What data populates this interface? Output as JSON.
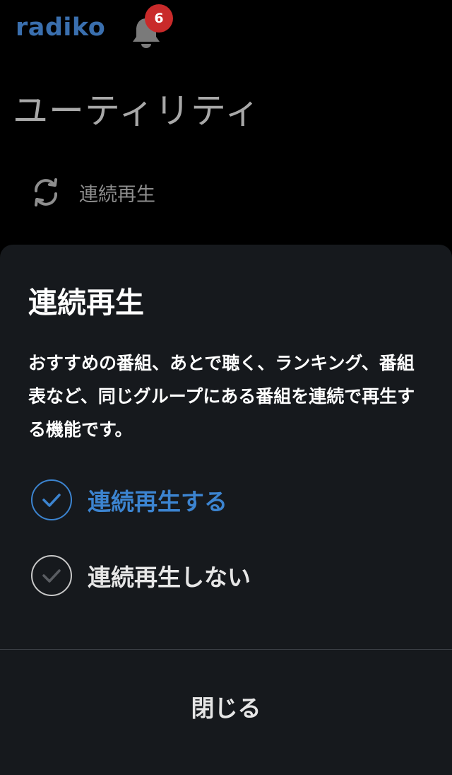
{
  "header": {
    "logo_text": "radiko",
    "notification_count": "6",
    "colors": {
      "logo": "#3a6fae",
      "badge": "#c92a2a",
      "bell": "#7a7a7a"
    },
    "icons": {
      "bell": "bell-icon"
    }
  },
  "page": {
    "title": "ユーティリティ",
    "menu_items": [
      {
        "label": "連続再生",
        "icon": "repeat-icon"
      }
    ]
  },
  "sheet": {
    "title": "連続再生",
    "description": "おすすめの番組、あとで聴く、ランキング、番組表など、同じグループにある番組を連続で再生する機能です。",
    "options": [
      {
        "label": "連続再生する",
        "selected": true,
        "icon": "check-circle-icon"
      },
      {
        "label": "連続再生しない",
        "selected": false,
        "icon": "check-circle-icon"
      }
    ],
    "close_label": "閉じる",
    "colors": {
      "background": "#16191d",
      "accent": "#3c84d0"
    }
  }
}
